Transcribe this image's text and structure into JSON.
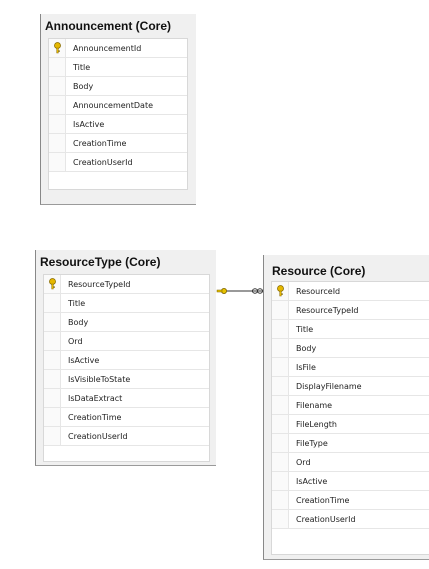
{
  "tables": {
    "announcement": {
      "title": "Announcement (Core)",
      "primary_key": "AnnouncementId",
      "columns": [
        "Title",
        "Body",
        "AnnouncementDate",
        "IsActive",
        "CreationTime",
        "CreationUserId"
      ]
    },
    "resource_type": {
      "title": "ResourceType (Core)",
      "primary_key": "ResourceTypeId",
      "columns": [
        "Title",
        "Body",
        "Ord",
        "IsActive",
        "IsVisibleToState",
        "IsDataExtract",
        "CreationTime",
        "CreationUserId"
      ]
    },
    "resource": {
      "title": "Resource (Core)",
      "primary_key": "ResourceId",
      "columns": [
        "ResourceTypeId",
        "Title",
        "Body",
        "IsFile",
        "DisplayFilename",
        "Filename",
        "FileLength",
        "FileType",
        "Ord",
        "IsActive",
        "CreationTime",
        "CreationUserId"
      ]
    }
  },
  "relationship": {
    "from": "ResourceType (Core)",
    "to": "Resource (Core)",
    "key_end_icon": "key-icon",
    "many_end_icon": "infinity-icon"
  }
}
